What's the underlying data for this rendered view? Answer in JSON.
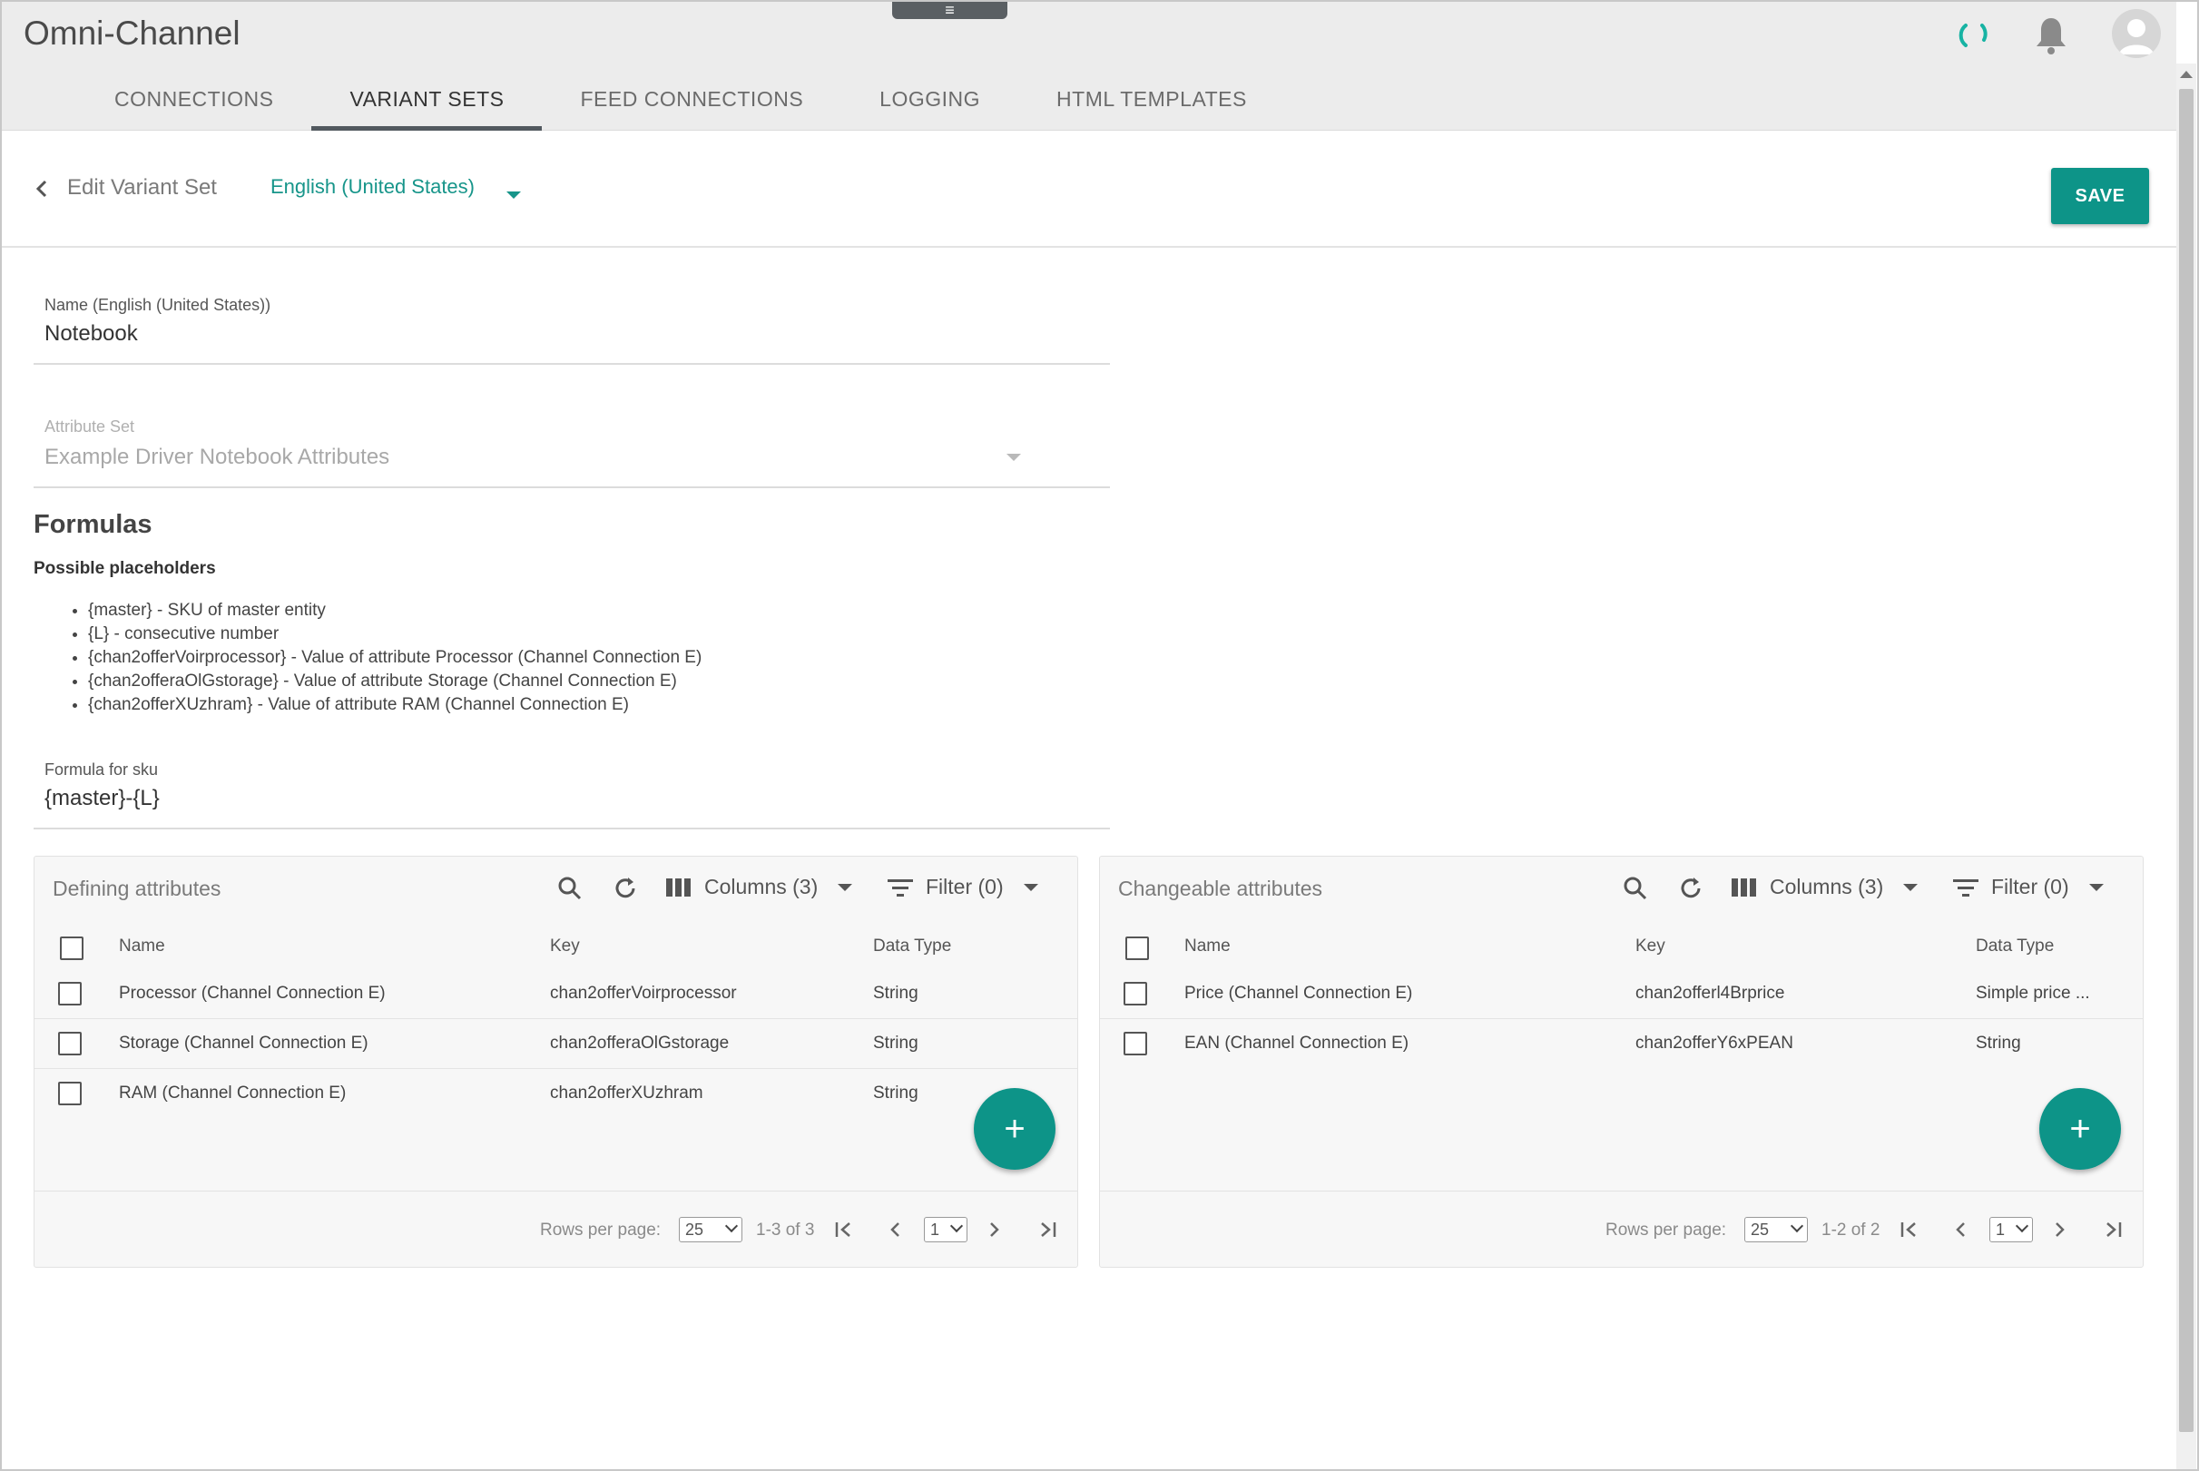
{
  "app": {
    "title": "Omni-Channel",
    "grip": "≡"
  },
  "tabs": [
    {
      "label": "CONNECTIONS",
      "active": false
    },
    {
      "label": "VARIANT SETS",
      "active": true
    },
    {
      "label": "FEED CONNECTIONS",
      "active": false
    },
    {
      "label": "LOGGING",
      "active": false
    },
    {
      "label": "HTML TEMPLATES",
      "active": false
    }
  ],
  "edit": {
    "title": "Edit Variant Set",
    "language": "English (United States)",
    "save_label": "SAVE"
  },
  "form": {
    "name_label": "Name (English (United States))",
    "name_value": "Notebook",
    "attribute_set_label": "Attribute Set",
    "attribute_set_value": "Example Driver Notebook Attributes",
    "formulas_heading": "Formulas",
    "placeholders_heading": "Possible placeholders",
    "placeholders": [
      "{master} - SKU of master entity",
      "{L} - consecutive number",
      "{chan2offerVoirprocessor} - Value of attribute Processor (Channel Connection E)",
      "{chan2offeraOlGstorage} - Value of attribute Storage (Channel Connection E)",
      "{chan2offerXUzhram} - Value of attribute RAM (Channel Connection E)"
    ],
    "sku_label": "Formula for sku",
    "sku_value": "{master}-{L}"
  },
  "defining": {
    "title": "Defining attributes",
    "columns_label": "Columns (3)",
    "filter_label": "Filter (0)",
    "headers": {
      "name": "Name",
      "key": "Key",
      "type": "Data Type"
    },
    "rows": [
      {
        "name": "Processor (Channel Connection E)",
        "key": "chan2offerVoirprocessor",
        "type": "String"
      },
      {
        "name": "Storage (Channel Connection E)",
        "key": "chan2offeraOlGstorage",
        "type": "String"
      },
      {
        "name": "RAM (Channel Connection E)",
        "key": "chan2offerXUzhram",
        "type": "String"
      }
    ],
    "rows_per_page_label": "Rows per page:",
    "rows_per_page": "25",
    "range": "1-3 of 3",
    "page": "1"
  },
  "changeable": {
    "title": "Changeable attributes",
    "columns_label": "Columns (3)",
    "filter_label": "Filter (0)",
    "headers": {
      "name": "Name",
      "key": "Key",
      "type": "Data Type"
    },
    "rows": [
      {
        "name": "Price (Channel Connection E)",
        "key": "chan2offerl4Brprice",
        "type": "Simple price ..."
      },
      {
        "name": "EAN (Channel Connection E)",
        "key": "chan2offerY6xPEAN",
        "type": "String"
      }
    ],
    "rows_per_page_label": "Rows per page:",
    "rows_per_page": "25",
    "range": "1-2 of 2",
    "page": "1"
  },
  "colors": {
    "accent": "#0d9488",
    "bar": "#ececec"
  },
  "icons": [
    "spinner-icon",
    "bell-icon",
    "avatar-icon",
    "back-arrow-icon",
    "search-icon",
    "refresh-icon",
    "columns-icon",
    "filter-icon",
    "add-icon",
    "first-page-icon",
    "prev-page-icon",
    "next-page-icon",
    "last-page-icon"
  ]
}
